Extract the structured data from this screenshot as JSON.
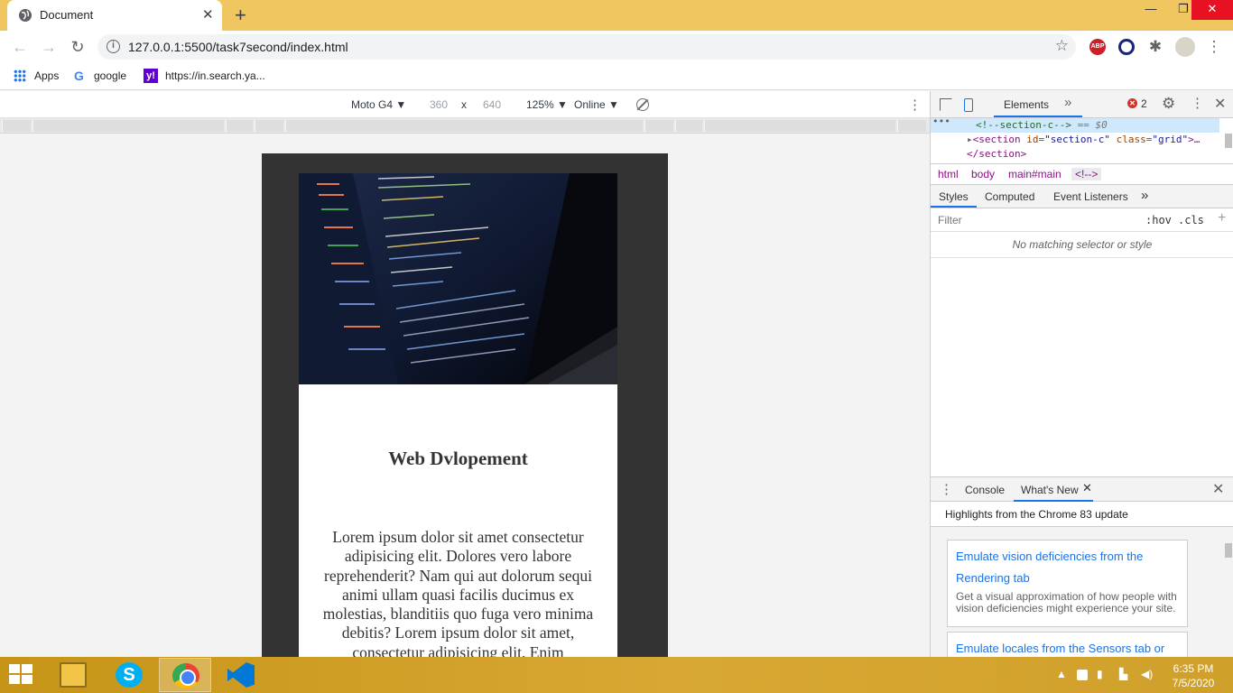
{
  "browser": {
    "tab_title": "Document",
    "tab_close": "✕",
    "new_tab": "+",
    "window_min": "—",
    "window_max": "❐",
    "window_close": "✕",
    "url": "127.0.0.1:5500/task7second/index.html",
    "bookmarks": [
      {
        "label": "Apps",
        "icon": "apps-grid-icon"
      },
      {
        "label": "google",
        "icon": "google-icon"
      },
      {
        "label": "https://in.search.ya...",
        "icon": "yahoo-icon"
      }
    ]
  },
  "device_toolbar": {
    "device": "Moto G4 ▼",
    "width": "360",
    "times": "x",
    "height": "640",
    "zoom": "125% ▼",
    "network": "Online ▼"
  },
  "page": {
    "title": "Web Dvlopement",
    "body": "Lorem ipsum dolor sit amet consectetur adipisicing elit. Dolores vero labore reprehenderit? Nam qui aut dolorum sequi animi ullam quasi facilis ducimus ex molestias, blanditiis quo fuga vero minima debitis? Lorem ipsum dolor sit amet, consectetur adipisicing elit. Enim"
  },
  "devtools": {
    "tabs": {
      "elements": "Elements",
      "more": "»"
    },
    "error_count": "2",
    "dom": {
      "dots": "•••",
      "selected": "<!--section-c-->",
      "selected_eq": " == $0",
      "section_open_tag": "<section",
      "section_attr_id": " id=",
      "section_id_val": "\"section-c\"",
      "section_attr_class": " class=",
      "section_class_val": "\"grid\"",
      "section_rest": ">…",
      "section_close": "</section>"
    },
    "breadcrumbs": [
      "html",
      "body",
      "main#main",
      "<!-->"
    ],
    "styles_tabs": [
      "Styles",
      "Computed",
      "Event Listeners",
      "»"
    ],
    "filter_placeholder": "Filter",
    "hov": ":hov",
    "cls": ".cls",
    "plus": "+",
    "no_match": "No matching selector or style",
    "drawer_tabs": [
      "Console",
      "What's New"
    ],
    "drawer_tab_close": "✕",
    "drawer_close": "✕",
    "highlights": "Highlights from the Chrome 83 update",
    "news": [
      {
        "title": "Emulate vision deficiencies from the Rendering tab",
        "desc": "Get a visual approximation of how people with vision deficiencies might experience your site."
      },
      {
        "title": "Emulate locales from the Sensors tab or",
        "desc": ""
      }
    ]
  },
  "taskbar": {
    "time": "6:35 PM",
    "date": "7/5/2020"
  }
}
